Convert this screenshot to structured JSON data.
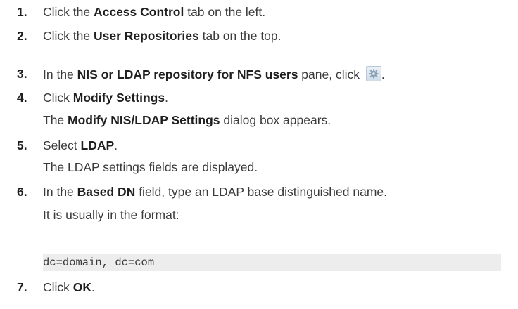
{
  "steps": [
    {
      "number": "1.",
      "parts": [
        "Click the ",
        "Access Control",
        " tab on the left."
      ]
    },
    {
      "number": "2.",
      "parts": [
        "Click the ",
        "User Repositories",
        " tab on the top."
      ]
    },
    {
      "number": "3.",
      "parts": [
        "In the ",
        "NIS or LDAP repository for NFS users",
        " pane, click ",
        "."
      ],
      "icon": "gear-settings-icon"
    },
    {
      "number": "4.",
      "parts": [
        "Click ",
        "Modify Settings",
        "."
      ],
      "sub": [
        "The ",
        "Modify NIS/LDAP Settings",
        " dialog box appears."
      ]
    },
    {
      "number": "5.",
      "parts": [
        "Select ",
        "LDAP",
        "."
      ],
      "sub": [
        "The LDAP settings fields are displayed."
      ]
    },
    {
      "number": "6.",
      "parts": [
        "In the ",
        "Based DN",
        " field, type an LDAP base distinguished name."
      ],
      "sub": [
        "It is usually in the format:"
      ],
      "code": "dc=domain, dc=com"
    },
    {
      "number": "7.",
      "parts": [
        "Click ",
        "OK",
        "."
      ]
    }
  ],
  "colors": {
    "text": "#3a3a3a",
    "bold_text": "#1f1f1f",
    "code_background": "#ededed"
  }
}
